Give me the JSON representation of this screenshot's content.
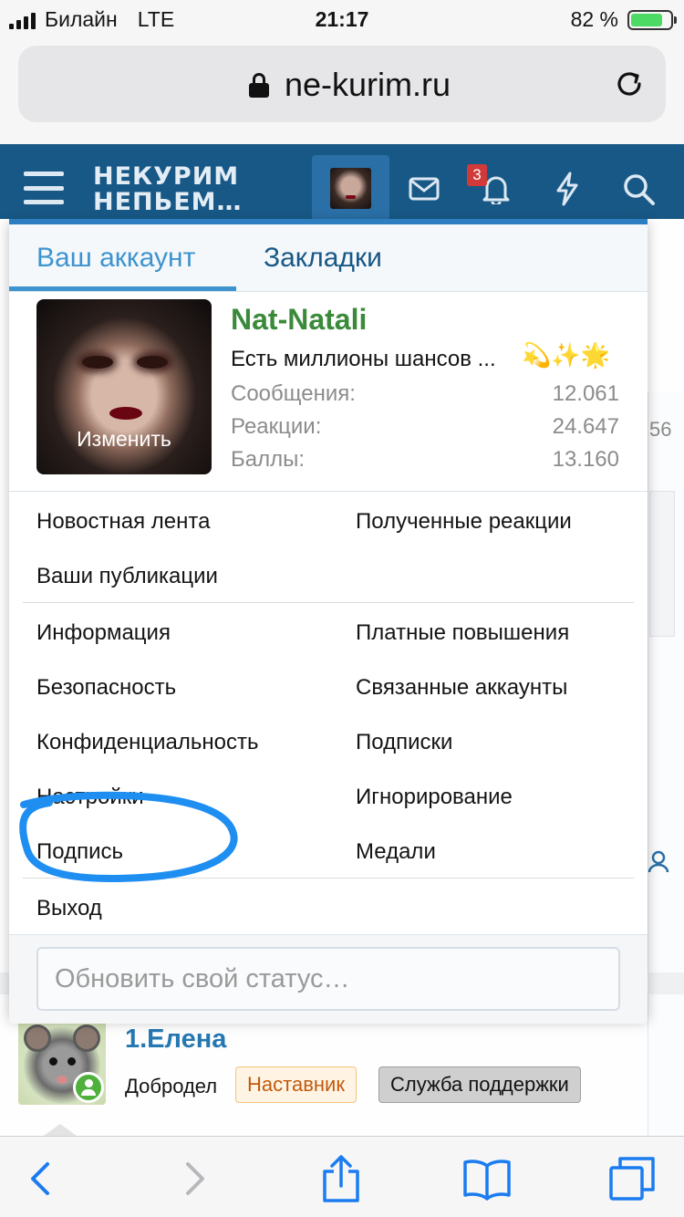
{
  "status_bar": {
    "carrier": "Билайн",
    "network": "LTE",
    "time": "21:17",
    "battery_percent": "82 %",
    "battery_level": 0.82
  },
  "browser": {
    "url": "ne-kurim.ru"
  },
  "site_header": {
    "logo_line1": "НЕКУРИМ",
    "logo_line2": "НЕПЬЕМ…",
    "notification_count": "3"
  },
  "account_menu": {
    "tabs": [
      {
        "label": "Ваш аккаунт",
        "active": true
      },
      {
        "label": "Закладки",
        "active": false
      }
    ],
    "profile": {
      "change_photo_label": "Изменить",
      "username": "Nat-Natali",
      "status": "Есть миллионы шансов ...",
      "status_emoji": "💫✨🌟",
      "stats": [
        {
          "label": "Сообщения:",
          "value": "12.061"
        },
        {
          "label": "Реакции:",
          "value": "24.647"
        },
        {
          "label": "Баллы:",
          "value": "13.160"
        }
      ]
    },
    "links_group1": {
      "left": [
        "Новостная лента",
        "Ваши публикации"
      ],
      "right": [
        "Полученные реакции"
      ]
    },
    "links_group2": {
      "left": [
        "Информация",
        "Безопасность",
        "Конфиденциальность",
        "Настройки",
        "Подпись"
      ],
      "right": [
        "Платные повышения",
        "Связанные аккаунты",
        "Подписки",
        "Игнорирование",
        "Медали"
      ]
    },
    "logout_label": "Выход",
    "status_input_placeholder": "Обновить свой статус…"
  },
  "background_page": {
    "number_fragment": "56",
    "user_name": "1.Елена",
    "user_title": "Добродел",
    "tags": [
      "Наставник",
      "Служба поддержки"
    ]
  },
  "colors": {
    "header_bg": "#185886",
    "accent": "#3e93cf",
    "username_green": "#3b8a3b",
    "annotation_blue": "#1f8ef1",
    "badge_red": "#d23a3a"
  },
  "icons": {
    "header": [
      "menu-icon",
      "mail-icon",
      "bell-icon",
      "lightning-icon",
      "search-icon"
    ],
    "toolbar": [
      "back-icon",
      "forward-icon",
      "share-icon",
      "bookmarks-icon",
      "tabs-icon"
    ]
  }
}
